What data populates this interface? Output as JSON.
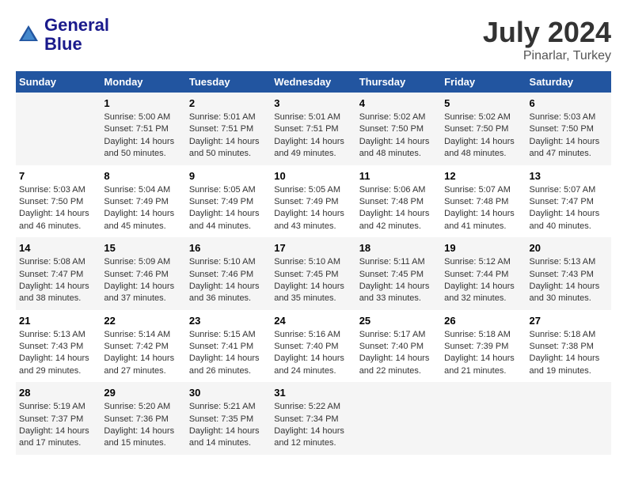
{
  "header": {
    "logo_line1": "General",
    "logo_line2": "Blue",
    "title": "July 2024",
    "subtitle": "Pinarlar, Turkey"
  },
  "calendar": {
    "days_of_week": [
      "Sunday",
      "Monday",
      "Tuesday",
      "Wednesday",
      "Thursday",
      "Friday",
      "Saturday"
    ],
    "weeks": [
      [
        {
          "day": "",
          "info": ""
        },
        {
          "day": "1",
          "info": "Sunrise: 5:00 AM\nSunset: 7:51 PM\nDaylight: 14 hours\nand 50 minutes."
        },
        {
          "day": "2",
          "info": "Sunrise: 5:01 AM\nSunset: 7:51 PM\nDaylight: 14 hours\nand 50 minutes."
        },
        {
          "day": "3",
          "info": "Sunrise: 5:01 AM\nSunset: 7:51 PM\nDaylight: 14 hours\nand 49 minutes."
        },
        {
          "day": "4",
          "info": "Sunrise: 5:02 AM\nSunset: 7:50 PM\nDaylight: 14 hours\nand 48 minutes."
        },
        {
          "day": "5",
          "info": "Sunrise: 5:02 AM\nSunset: 7:50 PM\nDaylight: 14 hours\nand 48 minutes."
        },
        {
          "day": "6",
          "info": "Sunrise: 5:03 AM\nSunset: 7:50 PM\nDaylight: 14 hours\nand 47 minutes."
        }
      ],
      [
        {
          "day": "7",
          "info": "Sunrise: 5:03 AM\nSunset: 7:50 PM\nDaylight: 14 hours\nand 46 minutes."
        },
        {
          "day": "8",
          "info": "Sunrise: 5:04 AM\nSunset: 7:49 PM\nDaylight: 14 hours\nand 45 minutes."
        },
        {
          "day": "9",
          "info": "Sunrise: 5:05 AM\nSunset: 7:49 PM\nDaylight: 14 hours\nand 44 minutes."
        },
        {
          "day": "10",
          "info": "Sunrise: 5:05 AM\nSunset: 7:49 PM\nDaylight: 14 hours\nand 43 minutes."
        },
        {
          "day": "11",
          "info": "Sunrise: 5:06 AM\nSunset: 7:48 PM\nDaylight: 14 hours\nand 42 minutes."
        },
        {
          "day": "12",
          "info": "Sunrise: 5:07 AM\nSunset: 7:48 PM\nDaylight: 14 hours\nand 41 minutes."
        },
        {
          "day": "13",
          "info": "Sunrise: 5:07 AM\nSunset: 7:47 PM\nDaylight: 14 hours\nand 40 minutes."
        }
      ],
      [
        {
          "day": "14",
          "info": "Sunrise: 5:08 AM\nSunset: 7:47 PM\nDaylight: 14 hours\nand 38 minutes."
        },
        {
          "day": "15",
          "info": "Sunrise: 5:09 AM\nSunset: 7:46 PM\nDaylight: 14 hours\nand 37 minutes."
        },
        {
          "day": "16",
          "info": "Sunrise: 5:10 AM\nSunset: 7:46 PM\nDaylight: 14 hours\nand 36 minutes."
        },
        {
          "day": "17",
          "info": "Sunrise: 5:10 AM\nSunset: 7:45 PM\nDaylight: 14 hours\nand 35 minutes."
        },
        {
          "day": "18",
          "info": "Sunrise: 5:11 AM\nSunset: 7:45 PM\nDaylight: 14 hours\nand 33 minutes."
        },
        {
          "day": "19",
          "info": "Sunrise: 5:12 AM\nSunset: 7:44 PM\nDaylight: 14 hours\nand 32 minutes."
        },
        {
          "day": "20",
          "info": "Sunrise: 5:13 AM\nSunset: 7:43 PM\nDaylight: 14 hours\nand 30 minutes."
        }
      ],
      [
        {
          "day": "21",
          "info": "Sunrise: 5:13 AM\nSunset: 7:43 PM\nDaylight: 14 hours\nand 29 minutes."
        },
        {
          "day": "22",
          "info": "Sunrise: 5:14 AM\nSunset: 7:42 PM\nDaylight: 14 hours\nand 27 minutes."
        },
        {
          "day": "23",
          "info": "Sunrise: 5:15 AM\nSunset: 7:41 PM\nDaylight: 14 hours\nand 26 minutes."
        },
        {
          "day": "24",
          "info": "Sunrise: 5:16 AM\nSunset: 7:40 PM\nDaylight: 14 hours\nand 24 minutes."
        },
        {
          "day": "25",
          "info": "Sunrise: 5:17 AM\nSunset: 7:40 PM\nDaylight: 14 hours\nand 22 minutes."
        },
        {
          "day": "26",
          "info": "Sunrise: 5:18 AM\nSunset: 7:39 PM\nDaylight: 14 hours\nand 21 minutes."
        },
        {
          "day": "27",
          "info": "Sunrise: 5:18 AM\nSunset: 7:38 PM\nDaylight: 14 hours\nand 19 minutes."
        }
      ],
      [
        {
          "day": "28",
          "info": "Sunrise: 5:19 AM\nSunset: 7:37 PM\nDaylight: 14 hours\nand 17 minutes."
        },
        {
          "day": "29",
          "info": "Sunrise: 5:20 AM\nSunset: 7:36 PM\nDaylight: 14 hours\nand 15 minutes."
        },
        {
          "day": "30",
          "info": "Sunrise: 5:21 AM\nSunset: 7:35 PM\nDaylight: 14 hours\nand 14 minutes."
        },
        {
          "day": "31",
          "info": "Sunrise: 5:22 AM\nSunset: 7:34 PM\nDaylight: 14 hours\nand 12 minutes."
        },
        {
          "day": "",
          "info": ""
        },
        {
          "day": "",
          "info": ""
        },
        {
          "day": "",
          "info": ""
        }
      ]
    ]
  }
}
